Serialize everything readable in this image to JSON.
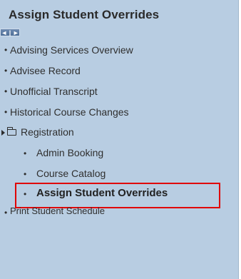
{
  "header": {
    "title": "Assign Student Overrides"
  },
  "collapse_control": {
    "label": "◄ | ►"
  },
  "nav": {
    "items": [
      {
        "label": "Advising Services Overview"
      },
      {
        "label": "Advisee Record"
      },
      {
        "label": "Unofficial Transcript"
      },
      {
        "label": "Historical Course Changes"
      }
    ],
    "folder": {
      "label": "Registration",
      "expanded": true,
      "children": [
        {
          "label": "Admin Booking"
        },
        {
          "label": "Course Catalog"
        },
        {
          "label": "Assign Student Overrides",
          "selected": true
        }
      ]
    },
    "after_items": [
      {
        "label": "Print Student Schedule"
      }
    ]
  },
  "colors": {
    "panel_bg": "#b8cde2",
    "highlight_border": "#e00000"
  }
}
